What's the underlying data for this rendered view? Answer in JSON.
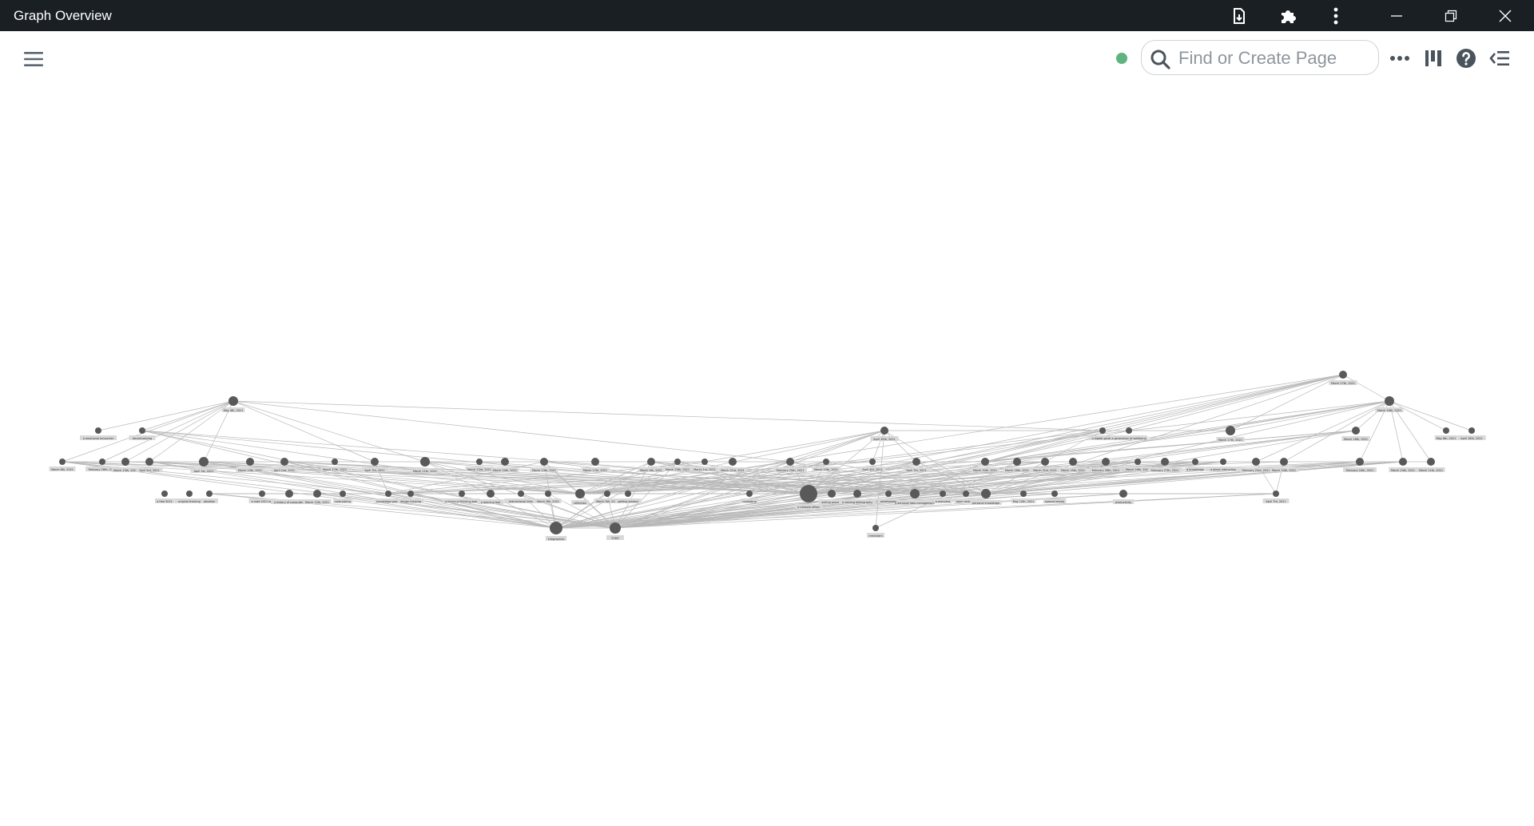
{
  "window": {
    "title": "Graph Overview",
    "controls": [
      "export-icon",
      "puzzle-icon",
      "more-vertical-icon",
      "minimize-icon",
      "restore-icon",
      "close-icon"
    ]
  },
  "toolbar": {
    "menu_icon": "hamburger-icon",
    "status_color": "#5fb37e",
    "search": {
      "placeholder": "Find or Create Page",
      "value": ""
    },
    "icons": [
      "more-horizontal-icon",
      "sidebar-toggle-icon",
      "help-icon",
      "right-sidebar-icon"
    ]
  },
  "colors": {
    "titlebar": "#1a1f24",
    "node": "#595959",
    "edge": "#b8b8b8",
    "label_bg": "#d9d9d9"
  },
  "graph": {
    "nodes": [
      {
        "id": "n1",
        "label": "March 27th, 2021"
      },
      {
        "id": "n2",
        "label": "March 16th, 2021"
      },
      {
        "id": "n3",
        "label": "May 8th, 2021"
      },
      {
        "id": "n4",
        "label": "a digital garden"
      },
      {
        "id": "n5",
        "label": "a generation of wellbeing"
      },
      {
        "id": "n6",
        "label": "March 17th, 2021"
      },
      {
        "id": "n7",
        "label": "March 18th, 2021"
      },
      {
        "id": "n8",
        "label": "April 18th, 2021"
      },
      {
        "id": "n9",
        "label": "May 4th, 2021"
      },
      {
        "id": "n10",
        "label": "April 10th, 2021"
      },
      {
        "id": "n11",
        "label": "a emotional encounter"
      },
      {
        "id": "n12",
        "label": "decentralizing "
      },
      {
        "id": "n13",
        "label": "March 6th, 2021"
      },
      {
        "id": "n14",
        "label": "February 26th, 2021"
      },
      {
        "id": "n15",
        "label": "March 19th, 2021"
      },
      {
        "id": "n16",
        "label": "April 3rd, 2021"
      },
      {
        "id": "n17",
        "label": "April 1st, 2021"
      },
      {
        "id": "n18",
        "label": "March 14th, 2021"
      },
      {
        "id": "n19",
        "label": "April 2nd, 2021"
      },
      {
        "id": "n20",
        "label": "March 27th, 2021"
      },
      {
        "id": "n21",
        "label": "April 7th, 2021"
      },
      {
        "id": "n22",
        "label": "March 11th, 2021"
      },
      {
        "id": "n23",
        "label": "March 23rd, 2021"
      },
      {
        "id": "n24",
        "label": "March 20th, 2021"
      },
      {
        "id": "n25",
        "label": "March 13th, 2021"
      },
      {
        "id": "n26",
        "label": "March 17th, 2021"
      },
      {
        "id": "n27",
        "label": "March 9th, 2021"
      },
      {
        "id": "n28",
        "label": "March 25th, 2021"
      },
      {
        "id": "n29",
        "label": "March 1st, 2021"
      },
      {
        "id": "n30",
        "label": "March 21st, 2021"
      },
      {
        "id": "n31",
        "label": "February 25th, 2021"
      },
      {
        "id": "n32",
        "label": "March 29th, 2021"
      },
      {
        "id": "n33",
        "label": "April 4th, 2021"
      },
      {
        "id": "n34",
        "label": "April 7th, 2021"
      },
      {
        "id": "n35",
        "label": "March 30th, 2021"
      },
      {
        "id": "n36",
        "label": "March 28th, 2021"
      },
      {
        "id": "n37",
        "label": "March 31st, 2021"
      },
      {
        "id": "n38",
        "label": "March 15th, 2021"
      },
      {
        "id": "n39",
        "label": "February 28th, 2021"
      },
      {
        "id": "n40",
        "label": "March 26th, 2021"
      },
      {
        "id": "n41",
        "label": "February 27th, 2021"
      },
      {
        "id": "n42",
        "label": "a knowledge"
      },
      {
        "id": "n43",
        "label": "a direct interaction"
      },
      {
        "id": "n44",
        "label": "February 23rd, 2021"
      },
      {
        "id": "n45",
        "label": "March 10th, 2021"
      },
      {
        "id": "n46",
        "label": "February 24th, 2021"
      },
      {
        "id": "n47",
        "label": "March 24th, 2021"
      },
      {
        "id": "n48",
        "label": "March 11th, 2021"
      },
      {
        "id": "n49",
        "label": "April 7th, 2021"
      },
      {
        "id": "n50",
        "label": "a free 3021"
      },
      {
        "id": "n51",
        "label": "original thinking"
      },
      {
        "id": "n52",
        "label": "obsidian"
      },
      {
        "id": "n53",
        "label": "a note 2021 lab"
      },
      {
        "id": "n54",
        "label": "a history of computers"
      },
      {
        "id": "n55",
        "label": "March 12th, 2021"
      },
      {
        "id": "n56",
        "label": "note-taking"
      },
      {
        "id": "n57",
        "label": "knowledge graph"
      },
      {
        "id": "n58",
        "label": "design thinking"
      },
      {
        "id": "n59",
        "label": "a future of thinking tools"
      },
      {
        "id": "n60",
        "label": "a learning tool"
      },
      {
        "id": "n61",
        "label": "bidirectional links"
      },
      {
        "id": "n62",
        "label": "March 8th, 2021"
      },
      {
        "id": "n63",
        "label": "reflection"
      },
      {
        "id": "n64",
        "label": "March 5th, 2021"
      },
      {
        "id": "n65",
        "label": "getting started"
      },
      {
        "id": "n66",
        "label": "marketing"
      },
      {
        "id": "n67",
        "label": "a network effect"
      },
      {
        "id": "n68",
        "label": "writing process"
      },
      {
        "id": "n69",
        "label": "a reading bibliography"
      },
      {
        "id": "n70",
        "label": "zettelkasten"
      },
      {
        "id": "n71",
        "label": "a personal idea management"
      },
      {
        "id": "n72",
        "label": "a overview"
      },
      {
        "id": "n73",
        "label": "roam research"
      },
      {
        "id": "n74",
        "label": "personal knowledge"
      },
      {
        "id": "n75",
        "label": "May 12th, 2021"
      },
      {
        "id": "n76",
        "label": "spaced review"
      },
      {
        "id": "n77",
        "label": "productivity"
      },
      {
        "id": "n78",
        "label": "infographics"
      },
      {
        "id": "n79",
        "label": "TODO"
      },
      {
        "id": "n80",
        "label": "reminders"
      }
    ]
  }
}
